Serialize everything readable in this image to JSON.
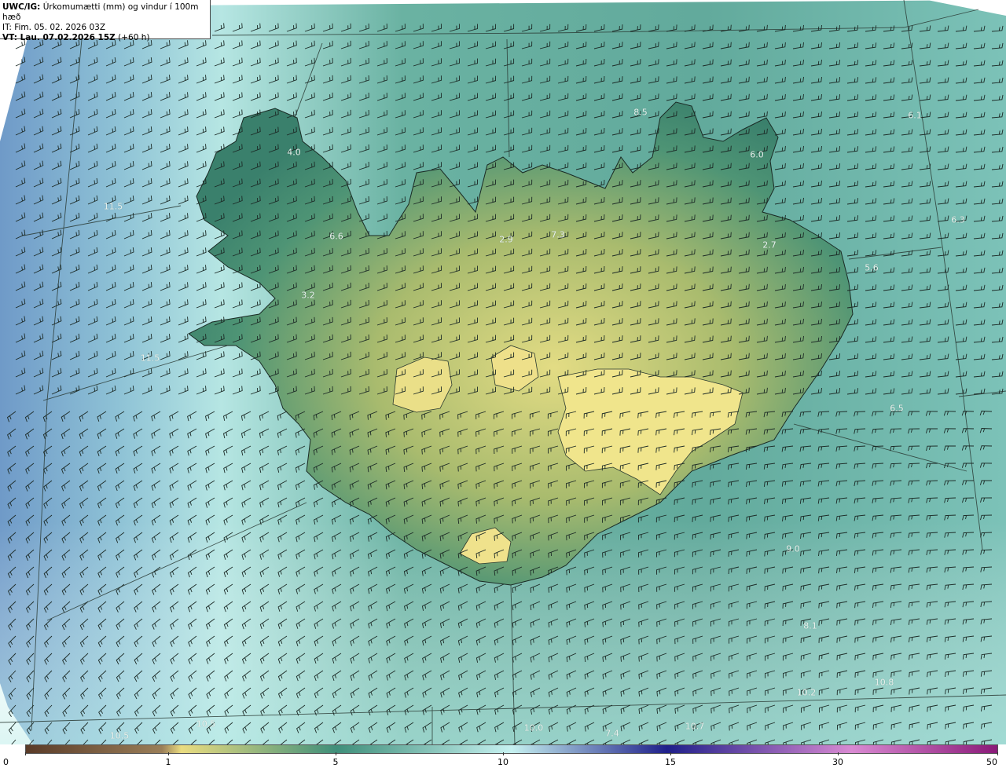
{
  "header": {
    "model": "UWC/IG:",
    "title": "Úrkomumætti (mm) og vindur í 100m hæð",
    "it_line": "IT: Fim. 05. 02. 2026 03Z",
    "vt_prefix": "VT: Lau. 07.02.2026 15Z",
    "vt_suffix": "(+60 h)"
  },
  "values": [
    {
      "id": "v1",
      "text": "4.0"
    },
    {
      "id": "v2",
      "text": "11.5"
    },
    {
      "id": "v3",
      "text": "6.6"
    },
    {
      "id": "v4",
      "text": "3.2"
    },
    {
      "id": "v5",
      "text": "11.5"
    },
    {
      "id": "v6",
      "text": "2.9"
    },
    {
      "id": "v7",
      "text": "7.3"
    },
    {
      "id": "v8",
      "text": "8.5"
    },
    {
      "id": "v9",
      "text": "6.0"
    },
    {
      "id": "v10",
      "text": "6.1"
    },
    {
      "id": "v11",
      "text": "2.7"
    },
    {
      "id": "v12",
      "text": "6.3"
    },
    {
      "id": "v13",
      "text": "5.6"
    },
    {
      "id": "v14",
      "text": "6.5"
    },
    {
      "id": "v15",
      "text": "9.0"
    },
    {
      "id": "v16",
      "text": "8.1"
    },
    {
      "id": "v17",
      "text": "10.2"
    },
    {
      "id": "v18",
      "text": "10.8"
    },
    {
      "id": "v19",
      "text": "10.5"
    },
    {
      "id": "v20",
      "text": "10.0"
    },
    {
      "id": "v21",
      "text": "7.4"
    },
    {
      "id": "v22",
      "text": "10.7"
    },
    {
      "id": "v23",
      "text": "10.5"
    }
  ],
  "colorbar": {
    "ticks": [
      "0",
      "1",
      "5",
      "10",
      "15",
      "30",
      "50"
    ],
    "colors": [
      "#5a3b28",
      "#9a7e58",
      "#eadc80",
      "#3f8f7a",
      "#c6f1f0",
      "#1f1f8a",
      "#d98ad2",
      "#8a1a78"
    ]
  }
}
